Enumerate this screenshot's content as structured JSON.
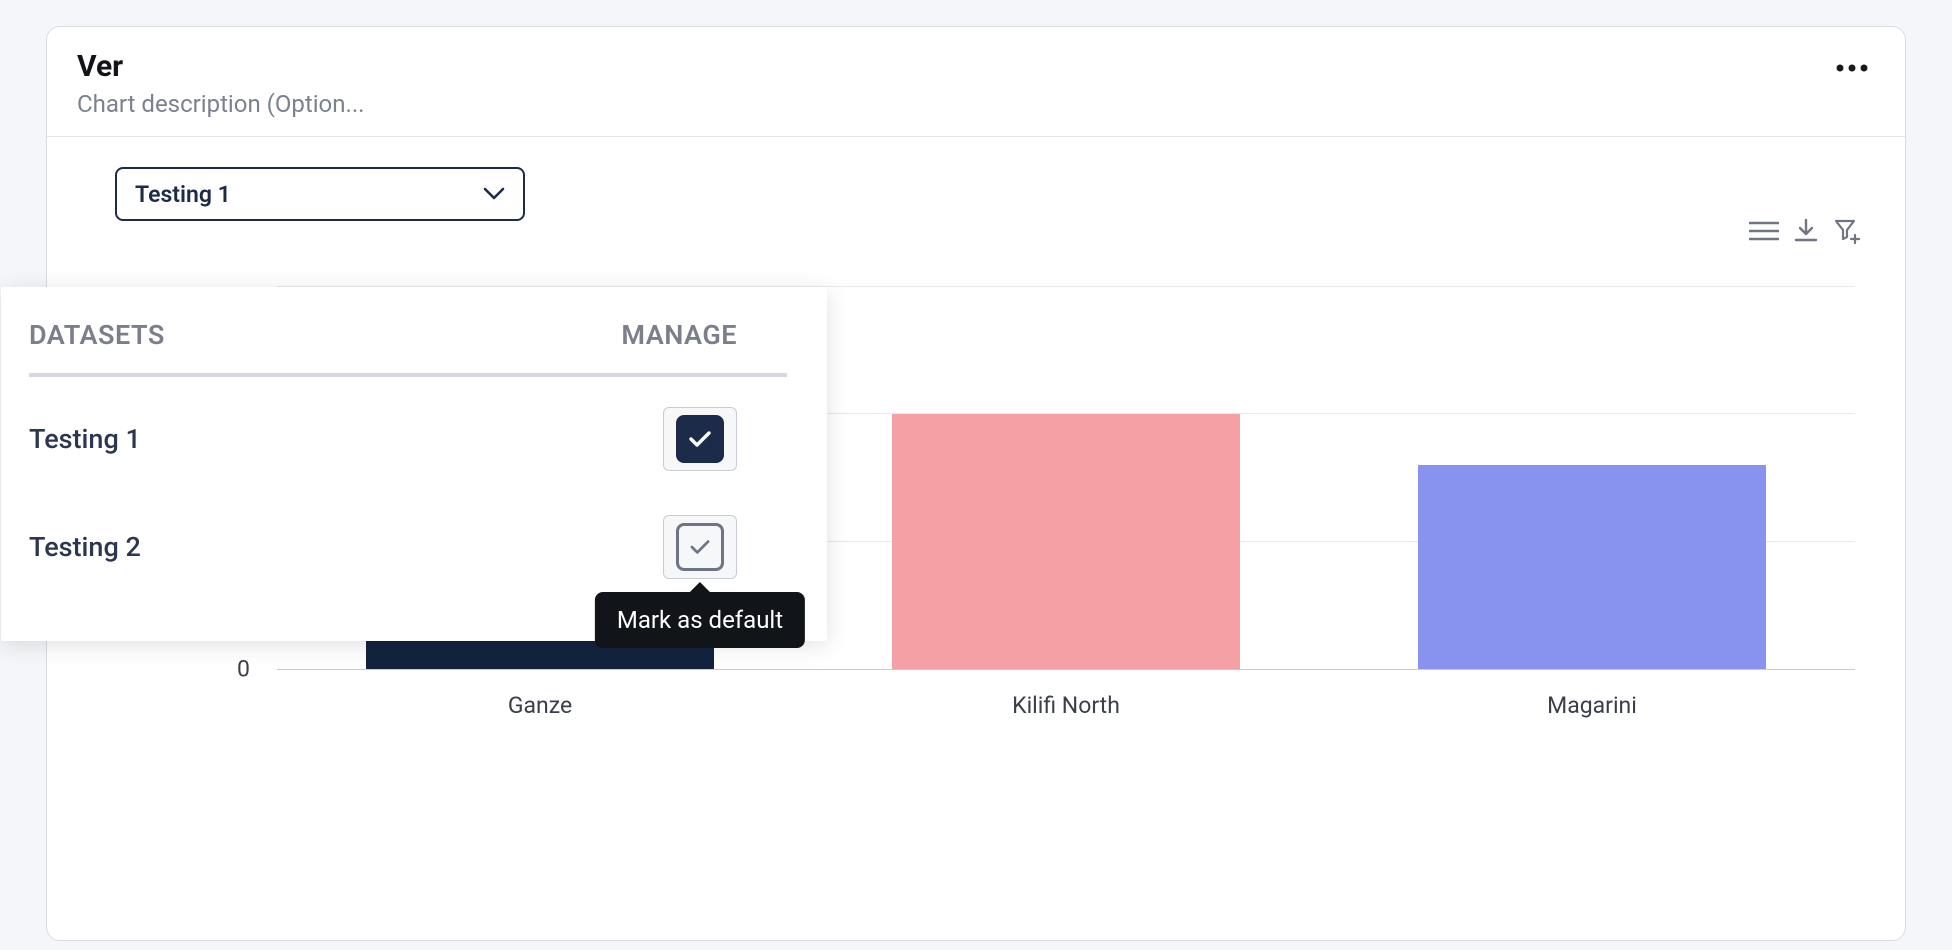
{
  "header": {
    "title": "Ver",
    "subtitle": "Chart description (Option..."
  },
  "select": {
    "selected_label": "Testing 1"
  },
  "dropdown": {
    "datasets_heading": "DATASETS",
    "manage_heading": "MANAGE",
    "tooltip": "Mark as default",
    "items": [
      {
        "label": "Testing 1",
        "is_default": true
      },
      {
        "label": "Testing 2",
        "is_default": false
      }
    ]
  },
  "chart_data": {
    "type": "bar",
    "categories": [
      "Ganze",
      "Kilifi North",
      "Magarini"
    ],
    "values": [
      1.25,
      1.0,
      0.8
    ],
    "colors": [
      "#13233f",
      "#f4a0a5",
      "#8793ee"
    ],
    "ylim": [
      0,
      1.5
    ],
    "y_ticks_shown": [
      0
    ],
    "gridlines_at": [
      0.5,
      1.0,
      1.5
    ],
    "xlabel": "",
    "ylabel": "",
    "title": ""
  }
}
